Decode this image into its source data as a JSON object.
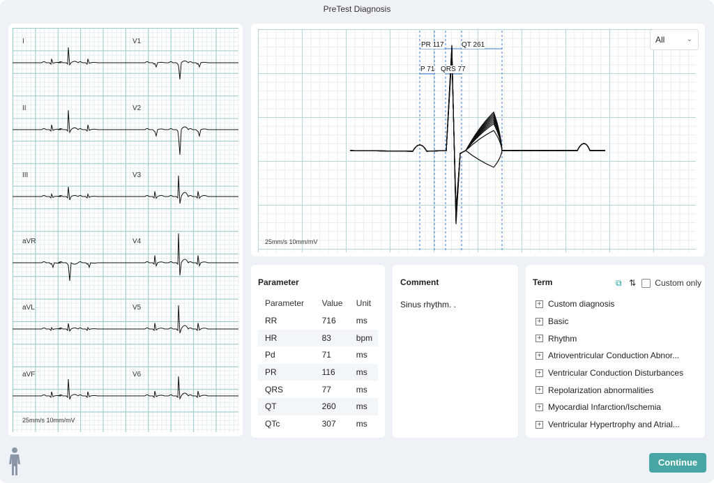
{
  "window": {
    "title": "PreTest Diagnosis"
  },
  "ecg12": {
    "leads": [
      "I",
      "V1",
      "II",
      "V2",
      "III",
      "V3",
      "aVR",
      "V4",
      "aVL",
      "V5",
      "aVF",
      "V6"
    ],
    "speed_label": "25mm/s  10mm/mV"
  },
  "median": {
    "select_value": "All",
    "intervals": {
      "pr": "PR 117",
      "qt": "QT 261",
      "p": "P 71",
      "qrs": "QRS 77"
    },
    "speed_label": "25mm/s  10mm/mV"
  },
  "parameter": {
    "title": "Parameter",
    "headers": [
      "Parameter",
      "Value",
      "Unit"
    ],
    "rows": [
      [
        "RR",
        "716",
        "ms"
      ],
      [
        "HR",
        "83",
        "bpm"
      ],
      [
        "Pd",
        "71",
        "ms"
      ],
      [
        "PR",
        "116",
        "ms"
      ],
      [
        "QRS",
        "77",
        "ms"
      ],
      [
        "QT",
        "260",
        "ms"
      ],
      [
        "QTc",
        "307",
        "ms"
      ]
    ]
  },
  "comment": {
    "title": "Comment",
    "text": "Sinus rhythm. ."
  },
  "term": {
    "title": "Term",
    "custom_only_label": "Custom only",
    "custom_only_checked": false,
    "items": [
      "Custom diagnosis",
      "Basic",
      "Rhythm",
      "Atrioventricular Conduction Abnor...",
      "Ventricular Conduction Disturbances",
      "Repolarization abnormalities",
      "Myocardial Infarction/Ischemia",
      "Ventricular Hypertrophy and Atrial..."
    ]
  },
  "footer": {
    "continue_label": "Continue"
  },
  "colors": {
    "accent": "#48a7a5",
    "grid_major": "#9cc9c9",
    "interval_marker": "#3a7bd5"
  }
}
